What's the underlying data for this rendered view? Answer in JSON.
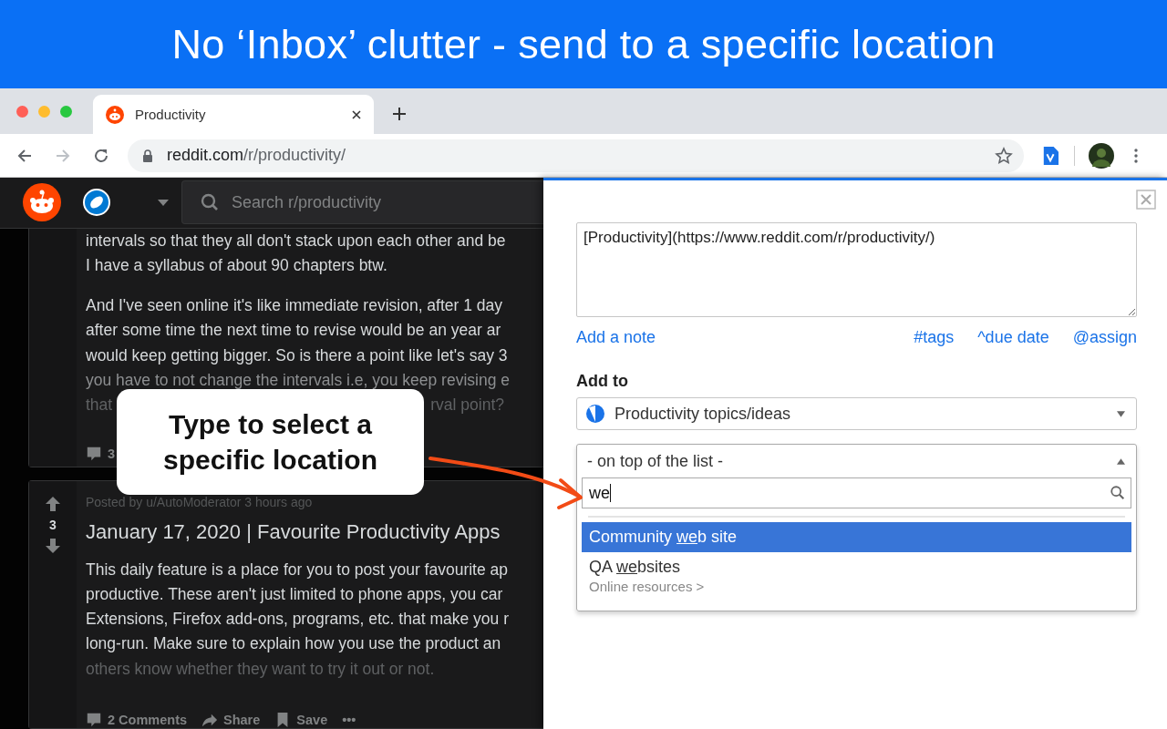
{
  "banner": {
    "headline": "No ‘Inbox’ clutter - send to a specific location"
  },
  "browser": {
    "tab": {
      "title": "Productivity",
      "selected": true
    },
    "address": {
      "host": "reddit.com",
      "path": "/r/productivity/"
    }
  },
  "reddit": {
    "search": {
      "placeholder": "Search r/productivity"
    },
    "post_top": {
      "paragraphs": [
        [
          {
            "segments": [
              "intervals so that they all don't stack upon each other and be"
            ],
            "dimmed": false,
            "faint": false
          },
          {
            "segments": [
              "I have a syllabus of about 90 chapters btw."
            ],
            "dimmed": false,
            "faint": false
          }
        ],
        [
          {
            "segments": [
              "And I've seen online it's like immediate revision, after 1 day"
            ],
            "dimmed": false,
            "faint": false
          },
          {
            "segments": [
              "after some time the next time to revise would be an year ar"
            ],
            "dimmed": false,
            "faint": false
          },
          {
            "segments": [
              "would keep getting bigger. So is there a point like let's say 3"
            ],
            "dimmed": false,
            "faint": false
          },
          {
            "segments": [
              "you have to not change the intervals i.e, you keep revising e"
            ],
            "dimmed": true,
            "faint": false
          },
          {
            "segments": [
              "that",
              "rval point?"
            ],
            "dimmed": true,
            "faint": true
          }
        ]
      ],
      "comments": "3"
    },
    "post": {
      "score": "3",
      "meta": "Posted by u/AutoModerator 3 hours ago",
      "title": "January 17, 2020 | Favourite Productivity Apps",
      "paragraphs": [
        [
          {
            "segments": [
              "This daily feature is a place for you to post your favourite ap"
            ],
            "dimmed": false,
            "faint": false
          },
          {
            "segments": [
              "productive. These aren't just limited to phone apps, you car"
            ],
            "dimmed": false,
            "faint": false
          },
          {
            "segments": [
              "Extensions, Firefox add-ons, programs, etc. that make you r"
            ],
            "dimmed": false,
            "faint": false
          },
          {
            "segments": [
              "long-run. Make sure to explain how you use the product an"
            ],
            "dimmed": false,
            "faint": false
          },
          {
            "segments": [
              "others know whether they want to try it out or not."
            ],
            "dimmed": true,
            "faint": true
          }
        ]
      ],
      "comments": "2 Comments",
      "share": "Share",
      "save": "Save",
      "more": "•••"
    }
  },
  "callout": {
    "text": "Type to select a specific location"
  },
  "panel": {
    "note": "[Productivity](https://www.reddit.com/r/productivity/)",
    "add_note": "Add a note",
    "shortcuts": [
      "#tags",
      "^due date",
      "@assign"
    ],
    "add_to_label": "Add to",
    "list": "Productivity topics/ideas",
    "position": {
      "value": "- on top of the list -",
      "expanded": true
    },
    "search": {
      "value": "we"
    },
    "results": [
      {
        "before": "Community ",
        "match": "we",
        "after": "b site",
        "selected": true
      },
      {
        "before": "QA ",
        "match": "we",
        "after": "bsites",
        "path": "Online resources >",
        "selected": false
      }
    ]
  }
}
